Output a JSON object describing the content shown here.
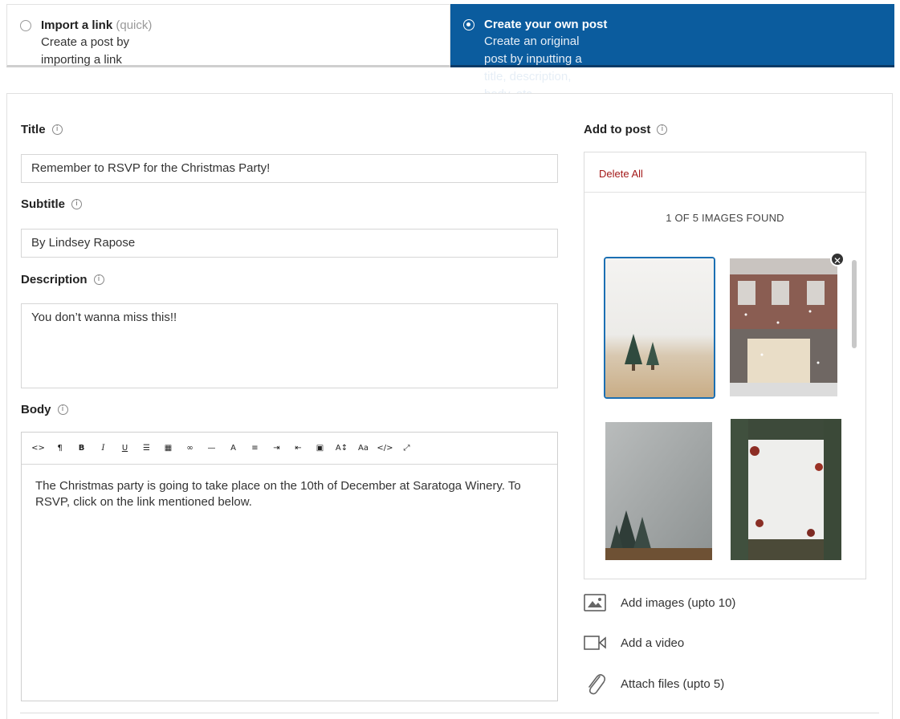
{
  "modes": {
    "import": {
      "title": "Import a link",
      "hint": "(quick)",
      "subtitle": "Create a post by importing a link"
    },
    "create": {
      "title": "Create your own post",
      "subtitle": "Create an original post by inputting a title, description, body, etc."
    }
  },
  "form": {
    "title_label": "Title",
    "title_value": "Remember to RSVP for the Christmas Party!",
    "subtitle_label": "Subtitle",
    "subtitle_value": "By Lindsey Rapose",
    "description_label": "Description",
    "description_value": "You don’t wanna miss this!!",
    "body_label": "Body",
    "body_value": "The Christmas party is going to take place on the 10th of December at Saratoga Winery. To RSVP, click on the link mentioned below.",
    "info_glyph": "i"
  },
  "toolbar": [
    {
      "name": "code-view-icon",
      "glyph": "<>"
    },
    {
      "name": "paragraph-icon",
      "glyph": "¶"
    },
    {
      "name": "bold-icon",
      "glyph": "B"
    },
    {
      "name": "italic-icon",
      "glyph": "I"
    },
    {
      "name": "underline-icon",
      "glyph": "U"
    },
    {
      "name": "bullet-list-icon",
      "glyph": "☰"
    },
    {
      "name": "table-icon",
      "glyph": "▦"
    },
    {
      "name": "link-icon",
      "glyph": "∞"
    },
    {
      "name": "horizontal-rule-icon",
      "glyph": "—"
    },
    {
      "name": "text-color-icon",
      "glyph": "A"
    },
    {
      "name": "align-left-icon",
      "glyph": "≡"
    },
    {
      "name": "indent-icon",
      "glyph": "⇥"
    },
    {
      "name": "outdent-icon",
      "glyph": "⇤"
    },
    {
      "name": "insert-image-icon",
      "glyph": "▣"
    },
    {
      "name": "font-size-icon",
      "glyph": "A↕"
    },
    {
      "name": "font-family-icon",
      "glyph": "Aa"
    },
    {
      "name": "html-icon",
      "glyph": "</>"
    },
    {
      "name": "fullscreen-icon",
      "glyph": "⤢"
    }
  ],
  "add_to_post": {
    "label": "Add to post",
    "delete_all": "Delete All",
    "count_text": "1 OF 5 IMAGES FOUND",
    "remove_glyph": "✕"
  },
  "actions": {
    "add_images": "Add images (upto 10)",
    "add_video": "Add a video",
    "attach_files": "Attach files (upto 5)"
  },
  "colors": {
    "accent": "#0b5c9e",
    "delete": "#a31919",
    "selected_border": "#1b6fb3"
  }
}
